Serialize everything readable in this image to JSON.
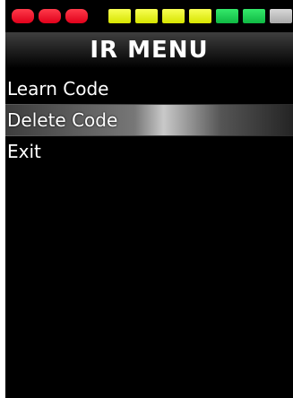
{
  "header": {
    "title": "IR MENU"
  },
  "level_meter": {
    "segments": [
      {
        "color": "#ff1a2e"
      },
      {
        "color": "#ff1a2e"
      },
      {
        "color": "#ff1a2e"
      },
      {
        "color": "#f3ff2a"
      },
      {
        "color": "#f3ff2a"
      },
      {
        "color": "#f3ff2a"
      },
      {
        "color": "#f3ff2a"
      },
      {
        "color": "#19d850"
      },
      {
        "color": "#19d850"
      },
      {
        "color": "#c0c0c0"
      }
    ]
  },
  "menu": {
    "items": [
      {
        "label": "Learn Code",
        "selected": false
      },
      {
        "label": "Delete Code",
        "selected": true
      },
      {
        "label": "Exit",
        "selected": false
      }
    ]
  }
}
